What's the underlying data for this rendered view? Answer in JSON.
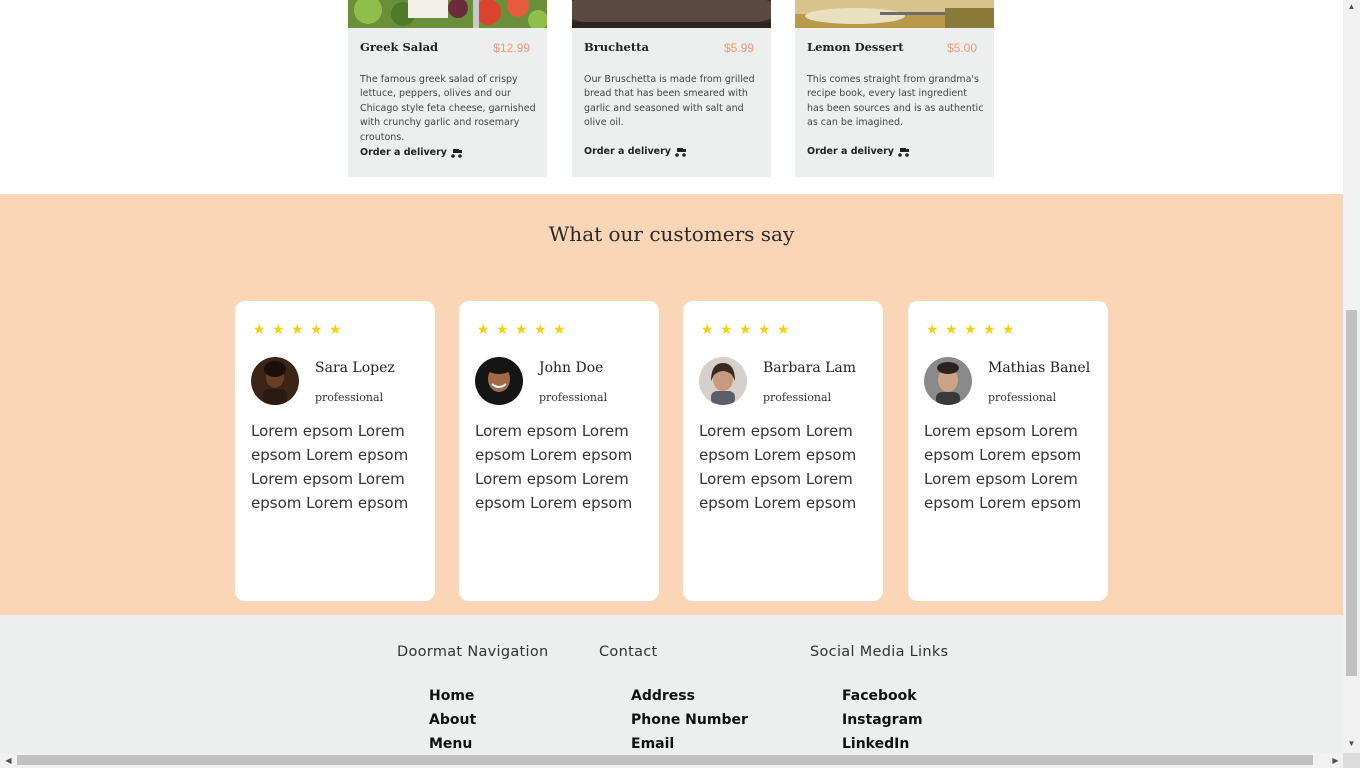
{
  "menu": {
    "dishes": [
      {
        "name": "Greek Salad",
        "price": "$12.99",
        "description": "The famous greek salad of crispy lettuce, peppers, olives and our Chicago style feta cheese, garnished with crunchy garlic and rosemary croutons.",
        "order_label": "Order a delivery",
        "image_icon": "salad-photo"
      },
      {
        "name": "Bruchetta",
        "price": "$5.99",
        "description": "Our Bruschetta is made from grilled bread that has been smeared with garlic and seasoned with salt and olive oil.",
        "order_label": "Order a delivery",
        "image_icon": "bruschetta-photo"
      },
      {
        "name": "Lemon Dessert",
        "price": "$5.00",
        "description": "This comes straight from grandma's recipe book, every last ingredient has been sources and is as authentic as can be imagined.",
        "order_label": "Order a delivery",
        "image_icon": "dessert-photo"
      }
    ]
  },
  "testimonials": {
    "title": "What our customers say",
    "reviews": [
      {
        "name": "Sara Lopez",
        "role": "professional",
        "rating": 5,
        "text": "Lorem epsom Lorem epsom Lorem epsom Lorem epsom Lorem epsom Lorem epsom"
      },
      {
        "name": "John Doe",
        "role": "professional",
        "rating": 5,
        "text": "Lorem epsom Lorem epsom Lorem epsom Lorem epsom Lorem epsom Lorem epsom"
      },
      {
        "name": "Barbara Lam",
        "role": "professional",
        "rating": 5,
        "text": "Lorem epsom Lorem epsom Lorem epsom Lorem epsom Lorem epsom Lorem epsom"
      },
      {
        "name": "Mathias Banel",
        "role": "professional",
        "rating": 5,
        "text": "Lorem epsom Lorem epsom Lorem epsom Lorem epsom Lorem epsom Lorem epsom"
      }
    ]
  },
  "footer": {
    "columns": [
      {
        "heading": "Doormat Navigation",
        "links": [
          "Home",
          "About",
          "Menu"
        ]
      },
      {
        "heading": "Contact",
        "links": [
          "Address",
          "Phone Number",
          "Email"
        ]
      },
      {
        "heading": "Social Media Links",
        "links": [
          "Facebook",
          "Instagram",
          "LinkedIn"
        ]
      }
    ]
  },
  "colors": {
    "accent_price": "#ee9972",
    "star": "#f4ce14",
    "testimonials_bg": "#fad6b6",
    "card_bg": "#edefee"
  }
}
